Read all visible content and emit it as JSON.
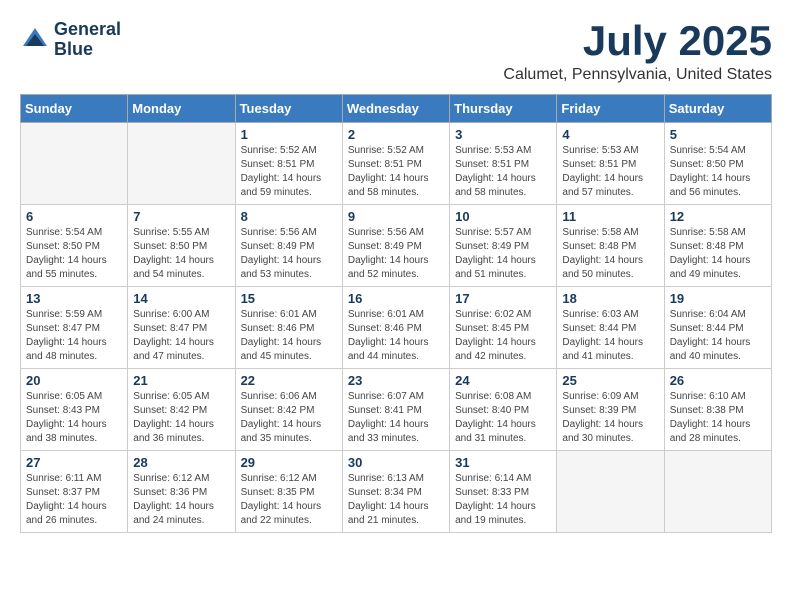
{
  "header": {
    "logo_line1": "General",
    "logo_line2": "Blue",
    "month": "July 2025",
    "location": "Calumet, Pennsylvania, United States"
  },
  "weekdays": [
    "Sunday",
    "Monday",
    "Tuesday",
    "Wednesday",
    "Thursday",
    "Friday",
    "Saturday"
  ],
  "weeks": [
    [
      {
        "day": "",
        "empty": true
      },
      {
        "day": "",
        "empty": true
      },
      {
        "day": "1",
        "sunrise": "5:52 AM",
        "sunset": "8:51 PM",
        "daylight": "14 hours and 59 minutes."
      },
      {
        "day": "2",
        "sunrise": "5:52 AM",
        "sunset": "8:51 PM",
        "daylight": "14 hours and 58 minutes."
      },
      {
        "day": "3",
        "sunrise": "5:53 AM",
        "sunset": "8:51 PM",
        "daylight": "14 hours and 58 minutes."
      },
      {
        "day": "4",
        "sunrise": "5:53 AM",
        "sunset": "8:51 PM",
        "daylight": "14 hours and 57 minutes."
      },
      {
        "day": "5",
        "sunrise": "5:54 AM",
        "sunset": "8:50 PM",
        "daylight": "14 hours and 56 minutes."
      }
    ],
    [
      {
        "day": "6",
        "sunrise": "5:54 AM",
        "sunset": "8:50 PM",
        "daylight": "14 hours and 55 minutes."
      },
      {
        "day": "7",
        "sunrise": "5:55 AM",
        "sunset": "8:50 PM",
        "daylight": "14 hours and 54 minutes."
      },
      {
        "day": "8",
        "sunrise": "5:56 AM",
        "sunset": "8:49 PM",
        "daylight": "14 hours and 53 minutes."
      },
      {
        "day": "9",
        "sunrise": "5:56 AM",
        "sunset": "8:49 PM",
        "daylight": "14 hours and 52 minutes."
      },
      {
        "day": "10",
        "sunrise": "5:57 AM",
        "sunset": "8:49 PM",
        "daylight": "14 hours and 51 minutes."
      },
      {
        "day": "11",
        "sunrise": "5:58 AM",
        "sunset": "8:48 PM",
        "daylight": "14 hours and 50 minutes."
      },
      {
        "day": "12",
        "sunrise": "5:58 AM",
        "sunset": "8:48 PM",
        "daylight": "14 hours and 49 minutes."
      }
    ],
    [
      {
        "day": "13",
        "sunrise": "5:59 AM",
        "sunset": "8:47 PM",
        "daylight": "14 hours and 48 minutes."
      },
      {
        "day": "14",
        "sunrise": "6:00 AM",
        "sunset": "8:47 PM",
        "daylight": "14 hours and 47 minutes."
      },
      {
        "day": "15",
        "sunrise": "6:01 AM",
        "sunset": "8:46 PM",
        "daylight": "14 hours and 45 minutes."
      },
      {
        "day": "16",
        "sunrise": "6:01 AM",
        "sunset": "8:46 PM",
        "daylight": "14 hours and 44 minutes."
      },
      {
        "day": "17",
        "sunrise": "6:02 AM",
        "sunset": "8:45 PM",
        "daylight": "14 hours and 42 minutes."
      },
      {
        "day": "18",
        "sunrise": "6:03 AM",
        "sunset": "8:44 PM",
        "daylight": "14 hours and 41 minutes."
      },
      {
        "day": "19",
        "sunrise": "6:04 AM",
        "sunset": "8:44 PM",
        "daylight": "14 hours and 40 minutes."
      }
    ],
    [
      {
        "day": "20",
        "sunrise": "6:05 AM",
        "sunset": "8:43 PM",
        "daylight": "14 hours and 38 minutes."
      },
      {
        "day": "21",
        "sunrise": "6:05 AM",
        "sunset": "8:42 PM",
        "daylight": "14 hours and 36 minutes."
      },
      {
        "day": "22",
        "sunrise": "6:06 AM",
        "sunset": "8:42 PM",
        "daylight": "14 hours and 35 minutes."
      },
      {
        "day": "23",
        "sunrise": "6:07 AM",
        "sunset": "8:41 PM",
        "daylight": "14 hours and 33 minutes."
      },
      {
        "day": "24",
        "sunrise": "6:08 AM",
        "sunset": "8:40 PM",
        "daylight": "14 hours and 31 minutes."
      },
      {
        "day": "25",
        "sunrise": "6:09 AM",
        "sunset": "8:39 PM",
        "daylight": "14 hours and 30 minutes."
      },
      {
        "day": "26",
        "sunrise": "6:10 AM",
        "sunset": "8:38 PM",
        "daylight": "14 hours and 28 minutes."
      }
    ],
    [
      {
        "day": "27",
        "sunrise": "6:11 AM",
        "sunset": "8:37 PM",
        "daylight": "14 hours and 26 minutes."
      },
      {
        "day": "28",
        "sunrise": "6:12 AM",
        "sunset": "8:36 PM",
        "daylight": "14 hours and 24 minutes."
      },
      {
        "day": "29",
        "sunrise": "6:12 AM",
        "sunset": "8:35 PM",
        "daylight": "14 hours and 22 minutes."
      },
      {
        "day": "30",
        "sunrise": "6:13 AM",
        "sunset": "8:34 PM",
        "daylight": "14 hours and 21 minutes."
      },
      {
        "day": "31",
        "sunrise": "6:14 AM",
        "sunset": "8:33 PM",
        "daylight": "14 hours and 19 minutes."
      },
      {
        "day": "",
        "empty": true
      },
      {
        "day": "",
        "empty": true
      }
    ]
  ]
}
